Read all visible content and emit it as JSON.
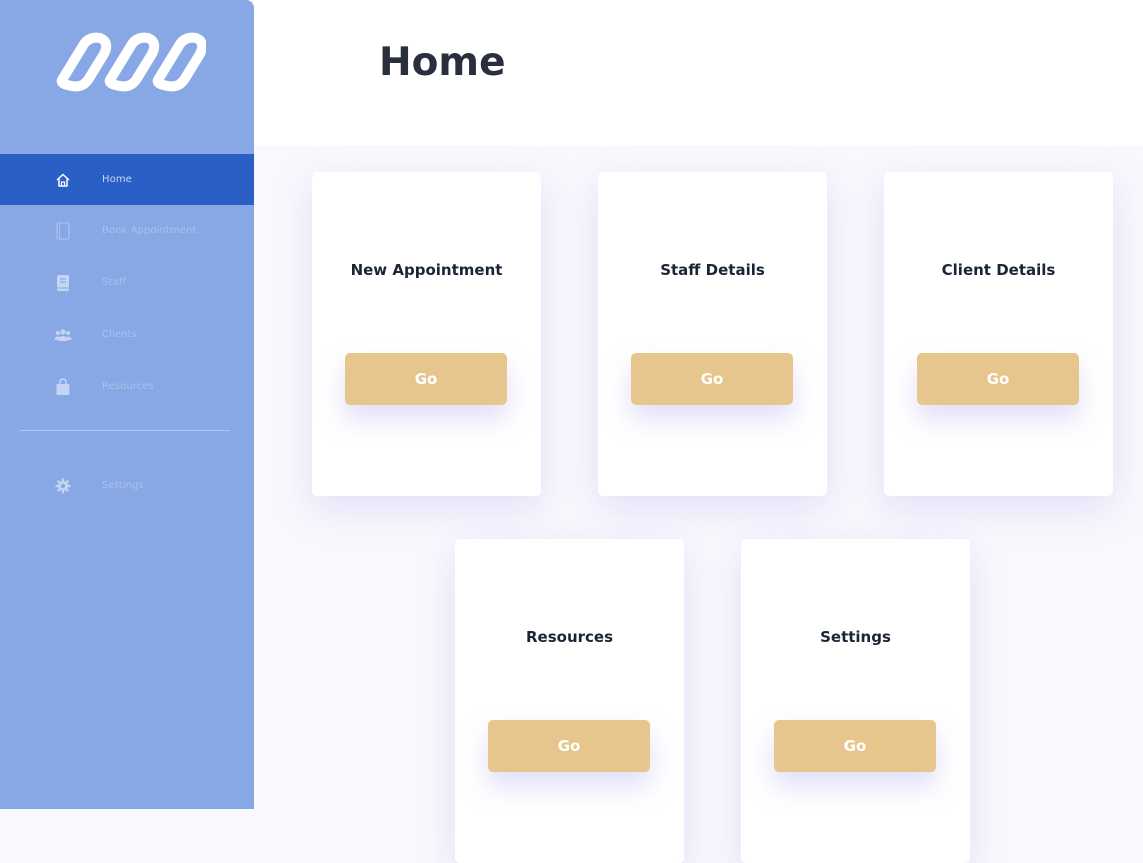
{
  "sidebar": {
    "items": [
      {
        "label": "Home",
        "icon": "home-icon"
      },
      {
        "label": "Book Appointment",
        "icon": "book-icon"
      },
      {
        "label": "Staff",
        "icon": "staff-book-icon"
      },
      {
        "label": "Clients",
        "icon": "users-icon"
      },
      {
        "label": "Resources",
        "icon": "bag-icon"
      },
      {
        "label": "Settings",
        "icon": "gear-icon"
      }
    ],
    "active_index": 0
  },
  "header": {
    "title": "Home"
  },
  "cards": [
    {
      "title": "New Appointment",
      "button": "Go"
    },
    {
      "title": "Staff Details",
      "button": "Go"
    },
    {
      "title": "Client Details",
      "button": "Go"
    },
    {
      "title": "Resources",
      "button": "Go"
    },
    {
      "title": "Settings",
      "button": "Go"
    }
  ],
  "colors": {
    "sidebar_bg": "#88a8e5",
    "sidebar_active": "#2a5fc6",
    "button": "#e6c68d",
    "content_bg": "#f8f8fd"
  }
}
